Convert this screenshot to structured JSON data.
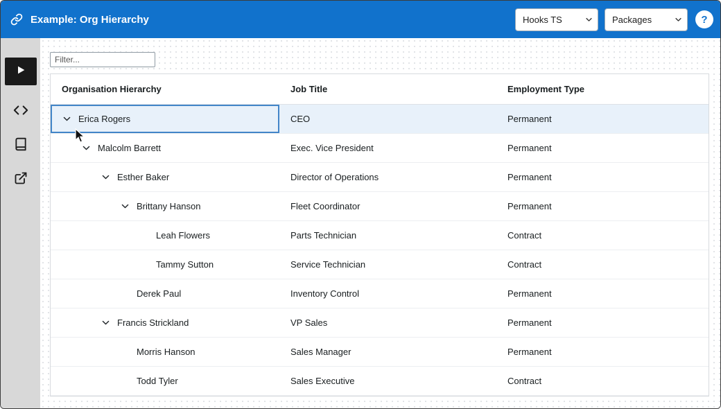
{
  "header": {
    "title": "Example: Org Hierarchy",
    "framework_select": {
      "value": "Hooks TS"
    },
    "packages_select": {
      "value": "Packages"
    },
    "help_label": "?"
  },
  "main": {
    "filter_placeholder": "Filter..."
  },
  "grid": {
    "columns": [
      "Organisation Hierarchy",
      "Job Title",
      "Employment Type"
    ],
    "rows": [
      {
        "name": "Erica Rogers",
        "level": 0,
        "expandable": true,
        "job": "CEO",
        "type": "Permanent",
        "selected": true
      },
      {
        "name": "Malcolm Barrett",
        "level": 1,
        "expandable": true,
        "job": "Exec. Vice President",
        "type": "Permanent",
        "selected": false
      },
      {
        "name": "Esther Baker",
        "level": 2,
        "expandable": true,
        "job": "Director of Operations",
        "type": "Permanent",
        "selected": false
      },
      {
        "name": "Brittany Hanson",
        "level": 3,
        "expandable": true,
        "job": "Fleet Coordinator",
        "type": "Permanent",
        "selected": false
      },
      {
        "name": "Leah Flowers",
        "level": 4,
        "expandable": false,
        "job": "Parts Technician",
        "type": "Contract",
        "selected": false
      },
      {
        "name": "Tammy Sutton",
        "level": 4,
        "expandable": false,
        "job": "Service Technician",
        "type": "Contract",
        "selected": false
      },
      {
        "name": "Derek Paul",
        "level": 3,
        "expandable": false,
        "job": "Inventory Control",
        "type": "Permanent",
        "selected": false
      },
      {
        "name": "Francis Strickland",
        "level": 2,
        "expandable": true,
        "job": "VP Sales",
        "type": "Permanent",
        "selected": false
      },
      {
        "name": "Morris Hanson",
        "level": 3,
        "expandable": false,
        "job": "Sales Manager",
        "type": "Permanent",
        "selected": false
      },
      {
        "name": "Todd Tyler",
        "level": 3,
        "expandable": false,
        "job": "Sales Executive",
        "type": "Contract",
        "selected": false
      }
    ]
  },
  "colors": {
    "header_bg": "#1172cc",
    "selected_row_bg": "#e8f1fa",
    "focus_border": "#4285c8",
    "sidebar_bg": "#d8d8d8"
  }
}
